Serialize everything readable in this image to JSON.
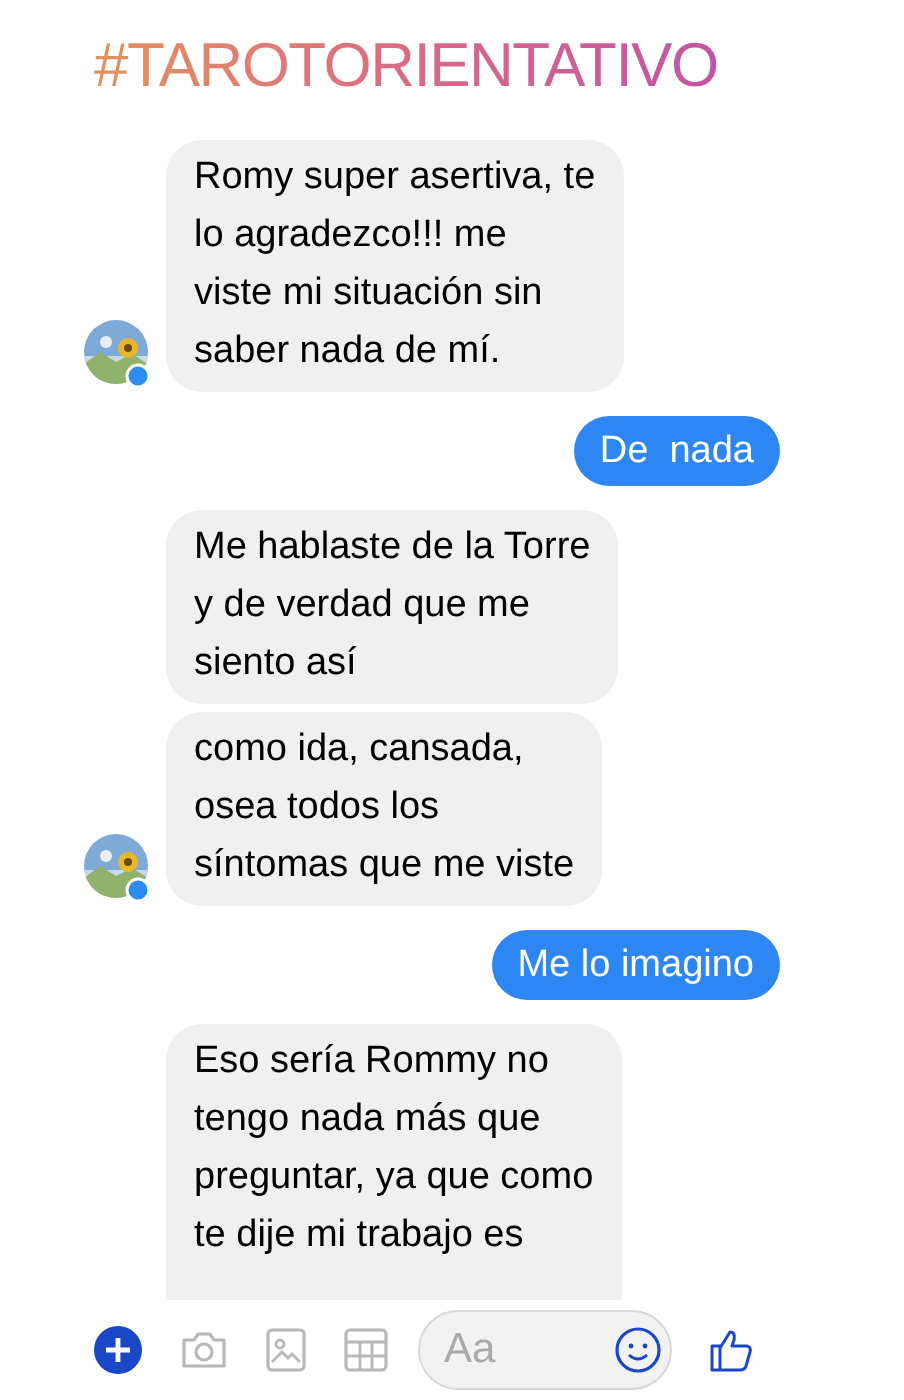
{
  "header": {
    "hashtag": "#TAROTORIENTATIVO"
  },
  "messages": [
    {
      "kind": "received",
      "avatar": true,
      "text": "Romy super asertiva, te\nlo agradezco!!! me\nviste mi situación sin\nsaber nada de mí."
    },
    {
      "kind": "sent",
      "text": "De  nada"
    },
    {
      "kind": "received",
      "avatar": false,
      "text": "Me hablaste de la Torre\ny de verdad que me\nsiento así"
    },
    {
      "kind": "received",
      "avatar": true,
      "text": "como ida, cansada,\nosea todos los\nsíntomas que me viste"
    },
    {
      "kind": "sent",
      "text": "Me lo imagino"
    },
    {
      "kind": "received",
      "avatar": false,
      "text": "Eso sería Rommy no\ntengo nada más que\npreguntar, ya que como\nte dije mi trabajo es"
    }
  ],
  "composer": {
    "placeholder": "Aa"
  }
}
